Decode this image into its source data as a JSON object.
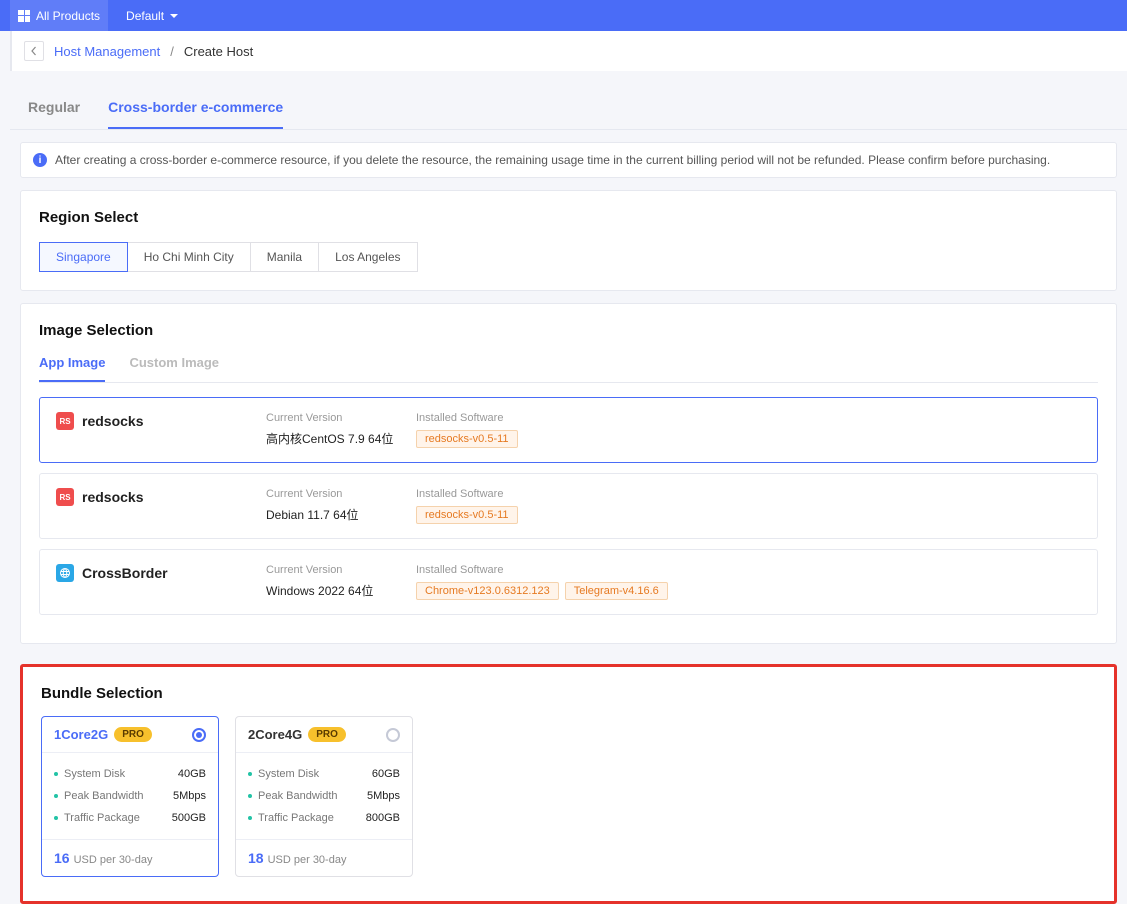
{
  "topbar": {
    "products_label": "All Products",
    "default_label": "Default"
  },
  "breadcrumb": {
    "parent": "Host Management",
    "current": "Create Host"
  },
  "top_tabs": [
    {
      "label": "Regular",
      "active": false
    },
    {
      "label": "Cross-border e-commerce",
      "active": true
    }
  ],
  "info_banner": "After creating a cross-border e-commerce resource, if you delete the resource, the remaining usage time in the current billing period will not be refunded. Please confirm before purchasing.",
  "region": {
    "title": "Region Select",
    "options": [
      {
        "label": "Singapore",
        "active": true
      },
      {
        "label": "Ho Chi Minh City",
        "active": false
      },
      {
        "label": "Manila",
        "active": false
      },
      {
        "label": "Los Angeles",
        "active": false
      }
    ]
  },
  "image": {
    "title": "Image Selection",
    "sub_tabs": [
      {
        "label": "App Image",
        "active": true
      },
      {
        "label": "Custom Image",
        "active": false
      }
    ],
    "version_label": "Current Version",
    "software_label": "Installed Software",
    "rows": [
      {
        "name": "redsocks",
        "badge": "RS",
        "badge_type": "rs",
        "version": "高内核CentOS 7.9 64位",
        "software": [
          "redsocks-v0.5-11"
        ],
        "selected": true
      },
      {
        "name": "redsocks",
        "badge": "RS",
        "badge_type": "rs",
        "version": "Debian 11.7 64位",
        "software": [
          "redsocks-v0.5-11"
        ],
        "selected": false
      },
      {
        "name": "CrossBorder",
        "badge": "CB",
        "badge_type": "cb",
        "version": "Windows 2022 64位",
        "software": [
          "Chrome-v123.0.6312.123",
          "Telegram-v4.16.6"
        ],
        "selected": false
      }
    ]
  },
  "bundle": {
    "title": "Bundle Selection",
    "specs": {
      "disk_label": "System Disk",
      "bw_label": "Peak Bandwidth",
      "traffic_label": "Traffic Package"
    },
    "price_suffix": "USD per 30-day",
    "options": [
      {
        "name": "1Core2G",
        "tag": "PRO",
        "disk": "40GB",
        "bw": "5Mbps",
        "traffic": "500GB",
        "price": "16",
        "selected": true
      },
      {
        "name": "2Core4G",
        "tag": "PRO",
        "disk": "60GB",
        "bw": "5Mbps",
        "traffic": "800GB",
        "price": "18",
        "selected": false
      }
    ]
  }
}
